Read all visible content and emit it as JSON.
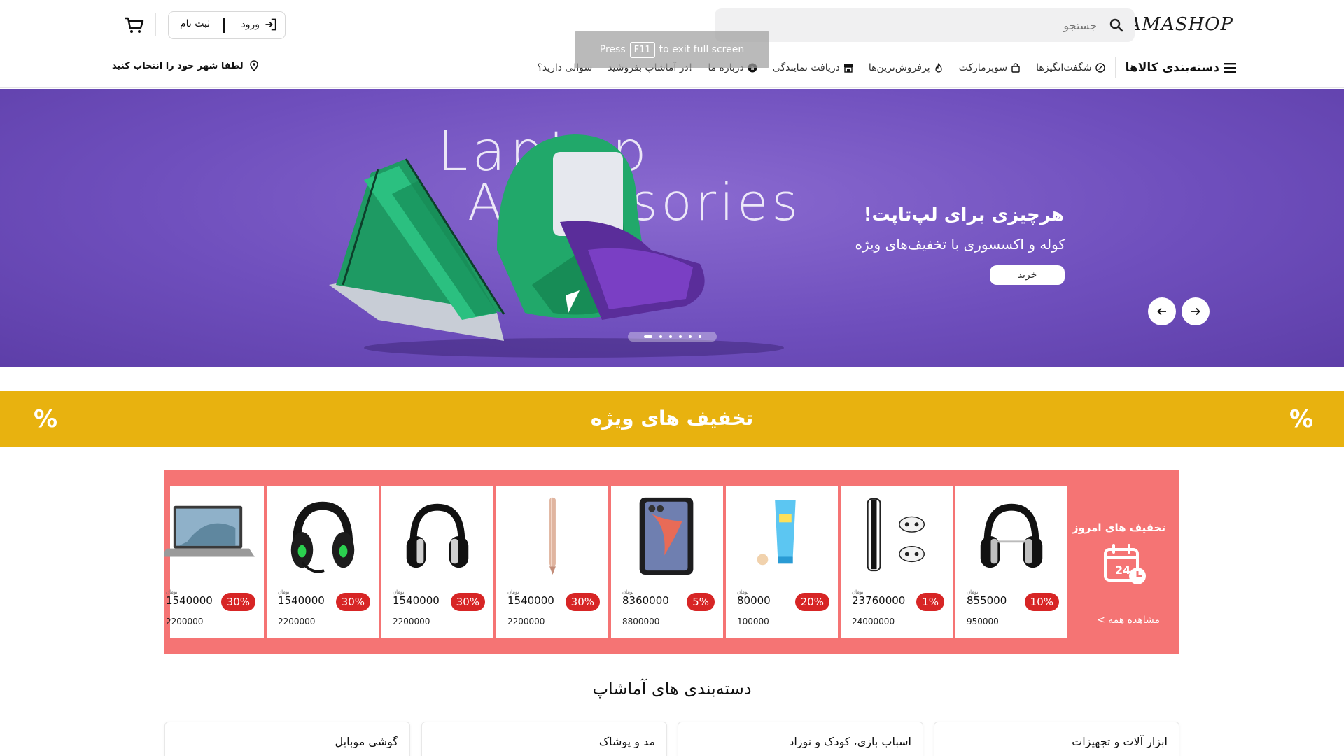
{
  "header": {
    "logo": "AMASHOP",
    "search_placeholder": "جستجو",
    "login": "ورود",
    "register": "ثبت نام",
    "city": "لطفا شهر خود را انتخاب کنید"
  },
  "nav": {
    "categories": "دسته‌بندی کالاها",
    "items": [
      "شگفت‌انگیزها",
      "سوپرمارکت",
      "پرفروش‌ترین‌ها",
      "دریافت نمایندگی",
      "درباره ما",
      "در آماشاپ بفروشید!",
      "سوالی دارید؟"
    ]
  },
  "fullscreen_toast": {
    "press": "Press",
    "key": "F11",
    "rest": "to exit full screen"
  },
  "hero": {
    "watermark_1": "Laptop",
    "watermark_2": "Accessories",
    "title": "هرچیزی برای لپ‌تاپت!",
    "subtitle": "کوله و اکسسوری با تخفیف‌های ویژه",
    "button": "خرید",
    "slide_count": 6,
    "active_slide": 1
  },
  "offers": {
    "title": "تخفیف های ویژه",
    "percent_symbol": "%"
  },
  "deals": {
    "title": "تخفیف های امروز",
    "calendar_day": "24",
    "view_all": "مشاهده همه >",
    "currency": "تومان",
    "items": [
      {
        "image": "headphones-silver",
        "discount": "10%",
        "price": "855000",
        "old_price": "950000"
      },
      {
        "image": "game-console",
        "discount": "1%",
        "price": "23760000",
        "old_price": "24000000"
      },
      {
        "image": "sunscreen-tube",
        "discount": "20%",
        "price": "80000",
        "old_price": "100000"
      },
      {
        "image": "smartphone",
        "discount": "5%",
        "price": "8360000",
        "old_price": "8800000"
      },
      {
        "image": "stylus-pen",
        "discount": "30%",
        "price": "1540000",
        "old_price": "2200000"
      },
      {
        "image": "headphones-black",
        "discount": "30%",
        "price": "1540000",
        "old_price": "2200000"
      },
      {
        "image": "gaming-headset",
        "discount": "30%",
        "price": "1540000",
        "old_price": "2200000"
      },
      {
        "image": "laptop",
        "discount": "30%",
        "price": "1540000",
        "old_price": "2200000"
      }
    ]
  },
  "categories": {
    "heading": "دسته‌بندی های آماشاپ",
    "items": [
      "ابزار آلات و تجهیزات",
      "اسباب بازی، کودک و نوزاد",
      "مد و پوشاک",
      "گوشی موبایل"
    ]
  },
  "colors": {
    "offer_strip": "#e8b20f",
    "deals_bg": "#f57474",
    "badge": "#d72525",
    "hero_bg": "#7458c4"
  }
}
